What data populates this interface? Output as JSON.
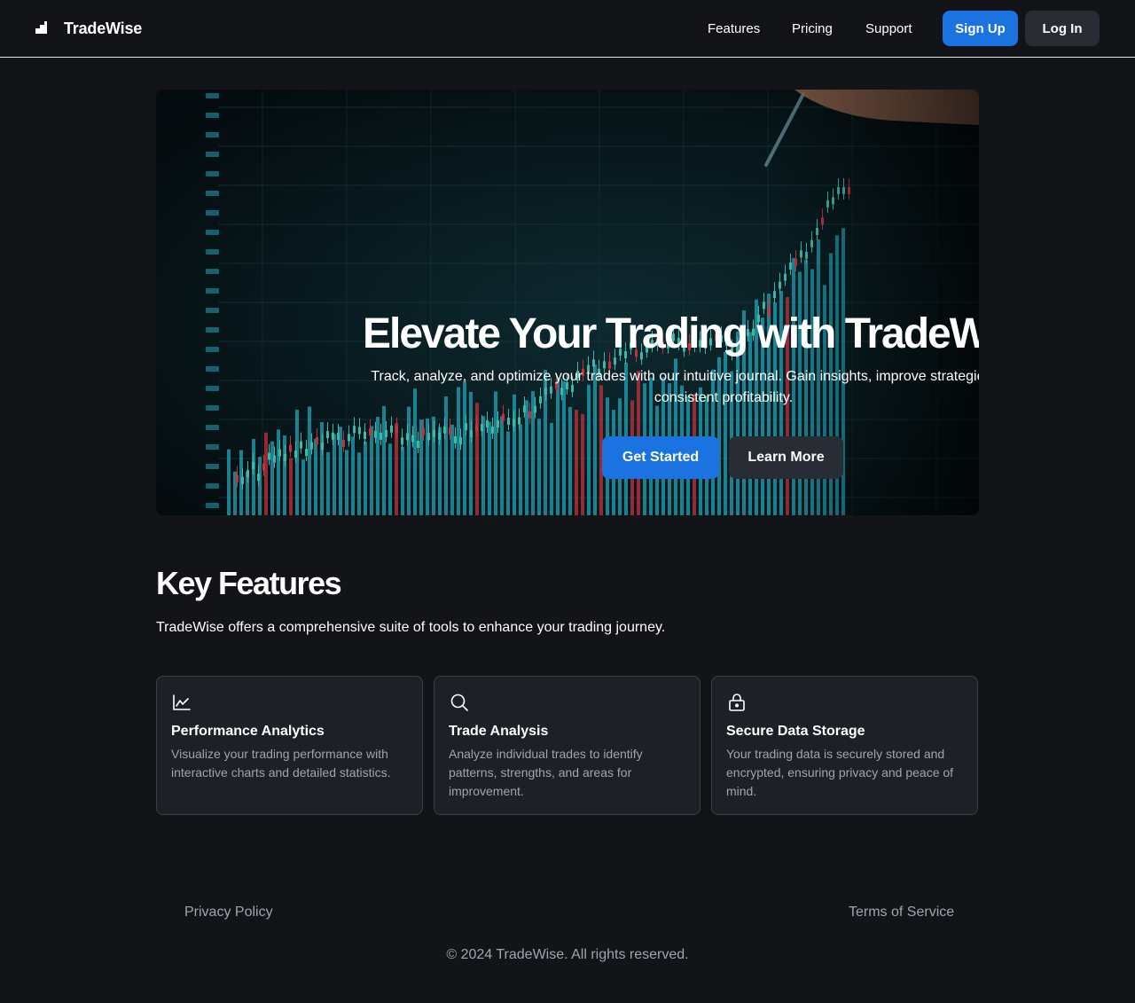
{
  "brand": {
    "name": "TradeWise",
    "logo_icon": "bar-steps-icon"
  },
  "nav": {
    "features": "Features",
    "pricing": "Pricing",
    "support": "Support",
    "signup": "Sign Up",
    "login": "Log In"
  },
  "hero": {
    "title": "Elevate Your Trading with TradeWise",
    "subtitle": "Track, analyze, and optimize your trades with our intuitive journal. Gain insights, improve strategies, and achieve consistent profitability.",
    "primary_cta": "Get Started",
    "secondary_cta": "Learn More",
    "background_image": "stock-chart-photo"
  },
  "features": {
    "title": "Key Features",
    "description": "TradeWise offers a comprehensive suite of tools to enhance your trading journey.",
    "cards": [
      {
        "icon": "line-chart-icon",
        "title": "Performance Analytics",
        "text": "Visualize your trading performance with interactive charts and detailed statistics."
      },
      {
        "icon": "search-icon",
        "title": "Trade Analysis",
        "text": "Analyze individual trades to identify patterns, strengths, and areas for improvement."
      },
      {
        "icon": "lock-icon",
        "title": "Secure Data Storage",
        "text": "Your trading data is securely stored and encrypted, ensuring privacy and peace of mind."
      }
    ]
  },
  "footer": {
    "privacy": "Privacy Policy",
    "terms": "Terms of Service",
    "copyright": "© 2024 TradeWise. All rights reserved."
  },
  "colors": {
    "background": "#121418",
    "accent": "#1a73e0",
    "secondary_button": "#272c35",
    "card_background": "#1d2127",
    "muted_text": "#9da5b1",
    "chart_teal": "#1fa6b8",
    "chart_red": "#c8303b"
  }
}
